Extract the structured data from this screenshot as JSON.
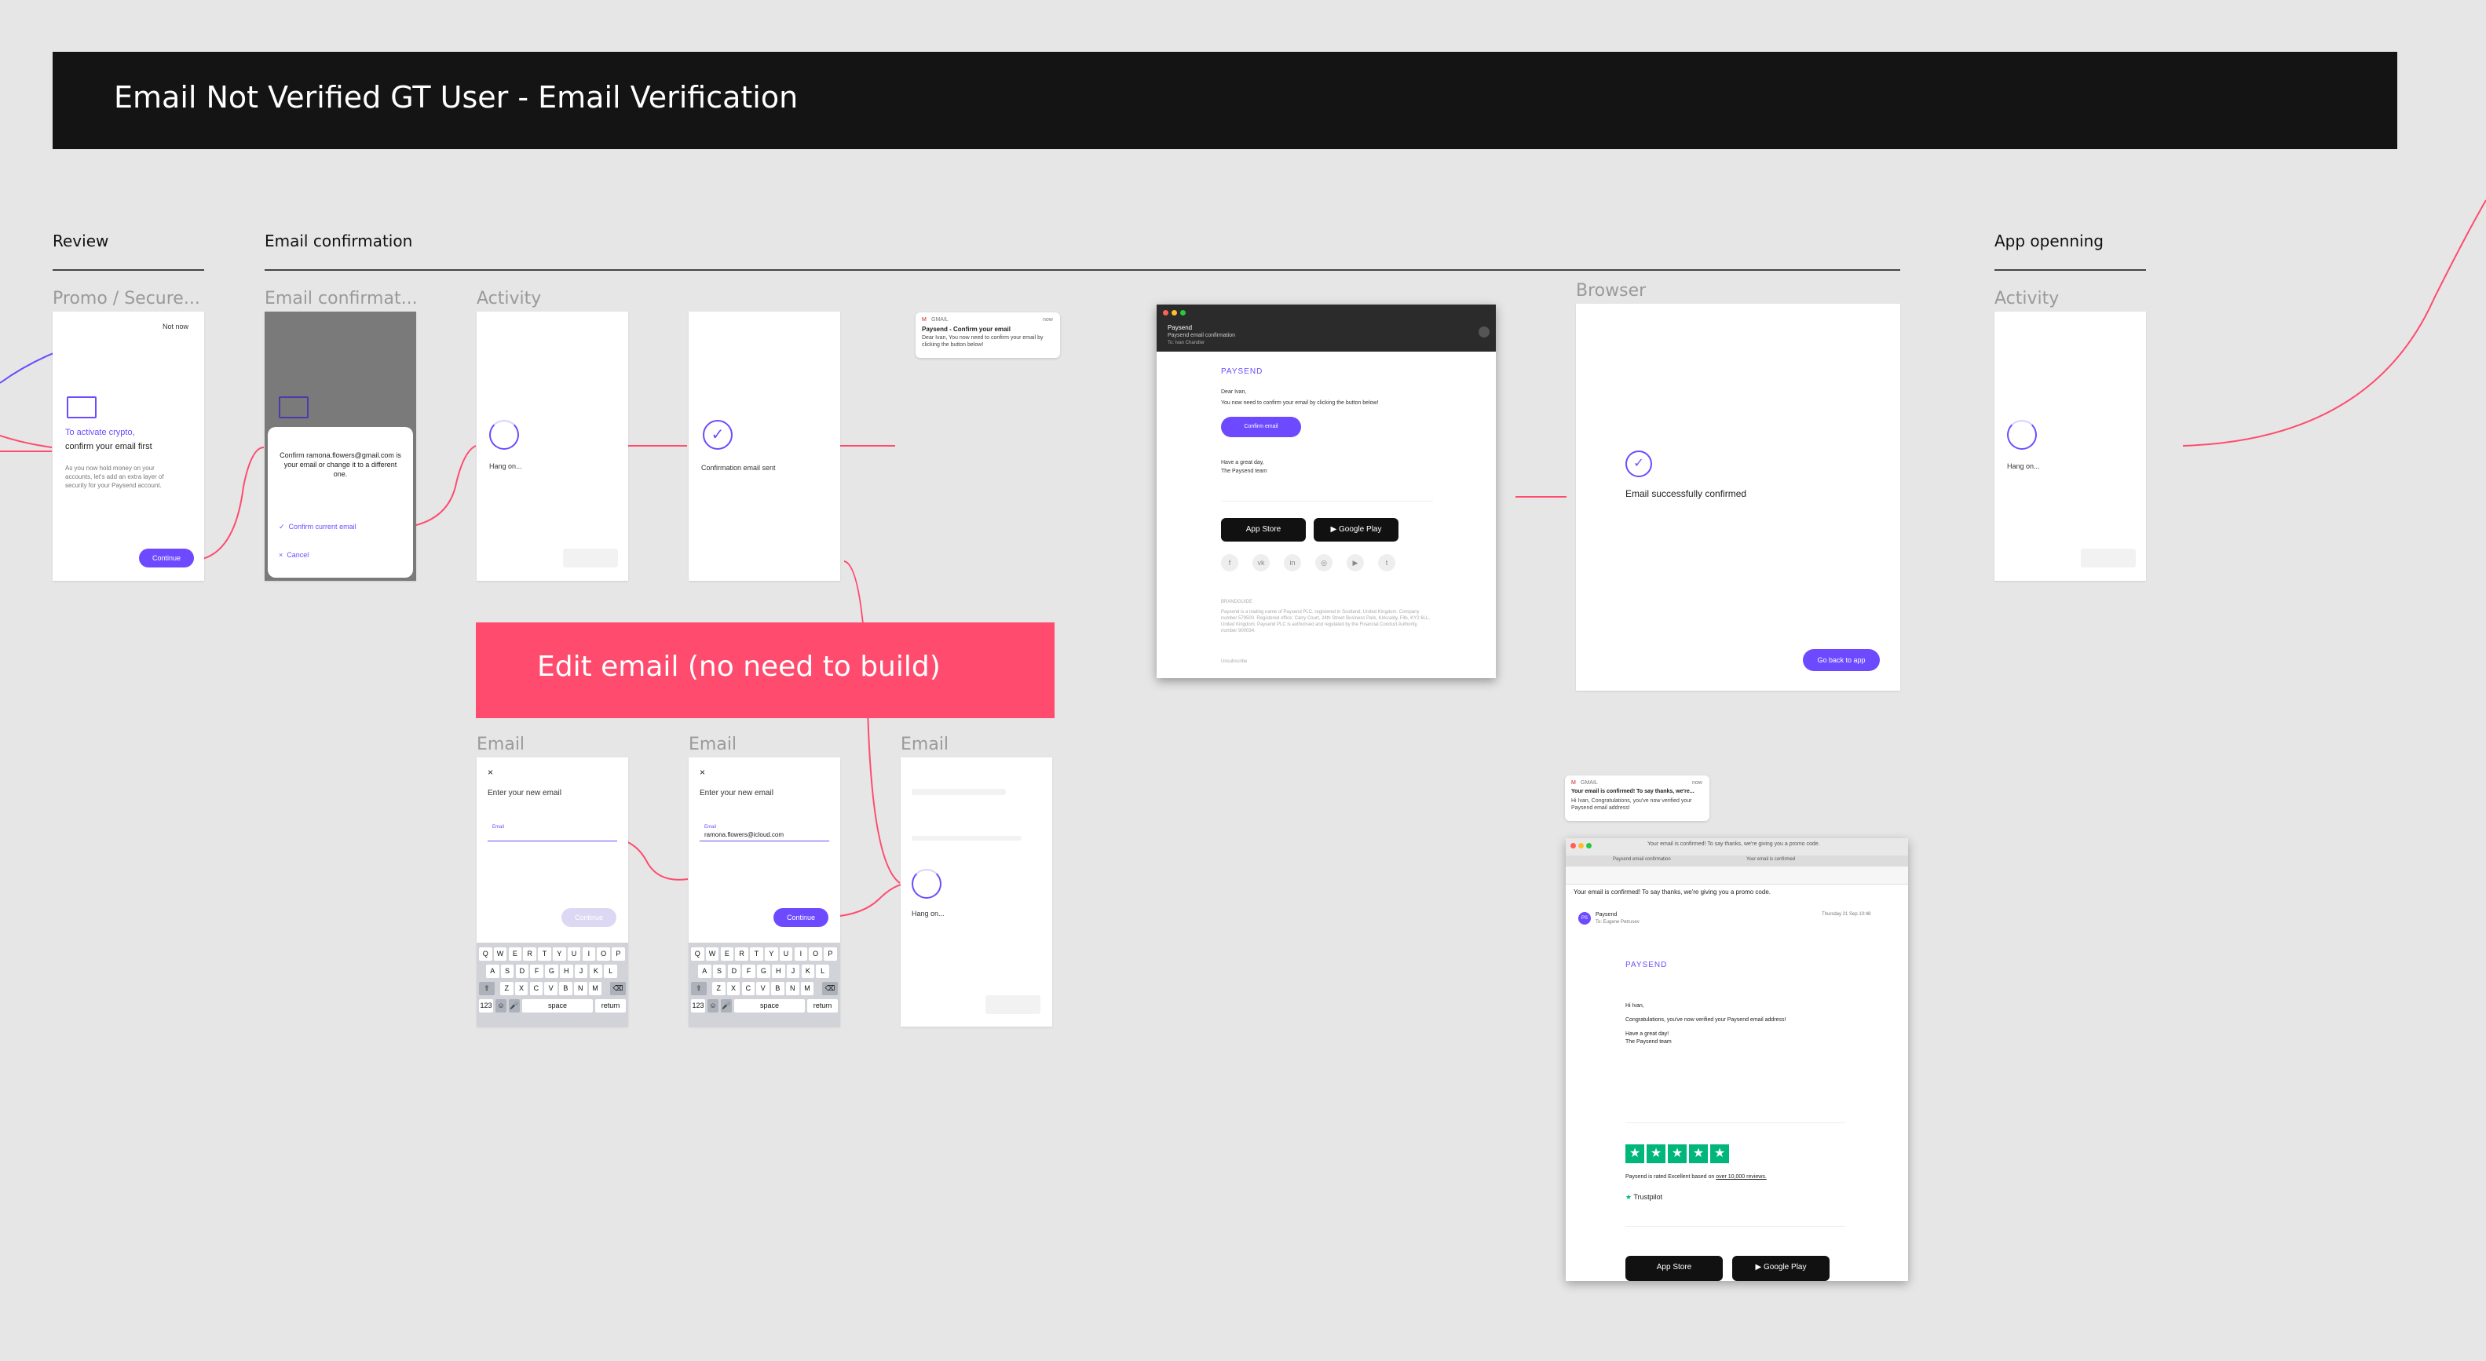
{
  "header": {
    "title": "Email Not Verified GT User - Email Verification"
  },
  "sections": {
    "review": "Review",
    "email_confirmation": "Email confirmation",
    "app_opening": "App openning"
  },
  "frame_labels": {
    "promo": "Promo / Secure...",
    "email_confirm": "Email confirmat...",
    "activity1": "Activity",
    "browser": "Browser",
    "activity2": "Activity",
    "email1": "Email",
    "email2": "Email",
    "email3": "Email"
  },
  "promo": {
    "not_now": "Not now",
    "title_purple": "To activate crypto,",
    "title_dark": "confirm your email first",
    "body": "As you now hold money on your accounts, let's add an extra layer of security for your Paysend account.",
    "continue": "Continue"
  },
  "confirm_sheet": {
    "text": "Confirm ramona.flowers@gmail.com is your email or change it to a different one.",
    "confirm": "Confirm current email",
    "cancel": "Cancel"
  },
  "activity": {
    "hang_on": "Hang on..."
  },
  "sent": {
    "text": "Confirmation email sent"
  },
  "gmail_notif1": {
    "app": "GMAIL",
    "time": "now",
    "title": "Paysend - Confirm your email",
    "body": "Dear Ivan, You now need to confirm your email by clicking the button below!"
  },
  "mail_app": {
    "from": "Paysend",
    "subject": "Paysend email confirmation",
    "to": "To: Ivan Chandler",
    "brand": "PAYSEND",
    "greeting": "Dear Ivan,",
    "line": "You now need to confirm your email by clicking the button below!",
    "button": "Confirm email",
    "signoff1": "Have a great day,",
    "signoff2": "The Paysend team",
    "app_store": "App Store",
    "google_play": "Google Play",
    "footer_label": "BRANDGUIDE",
    "footer": "Paysend is a trading name of Paysend PLC, registered in Scotland, United Kingdom. Company number 579500. Registered office: Carry Court, 24th Street Business Park, Kirkcaldy, Fife, KY2 6LL, United Kingdom. Paysend PLC is authorised and regulated by the Financial Conduct Authority, number 900034.",
    "unsubscribe": "Unsubscribe"
  },
  "browser": {
    "text": "Email successfully confirmed",
    "button": "Go back to app"
  },
  "pink_banner": {
    "text": "Edit email (no need to build)"
  },
  "email_screen1": {
    "close": "×",
    "title": "Enter your new email",
    "field_label": "Email",
    "value": "",
    "button": "Continue"
  },
  "email_screen2": {
    "close": "×",
    "title": "Enter your new email",
    "field_label": "Email",
    "value": "ramona.flowers@icloud.com",
    "button": "Continue"
  },
  "keyboard": {
    "row1": [
      "Q",
      "W",
      "E",
      "R",
      "T",
      "Y",
      "U",
      "I",
      "O",
      "P"
    ],
    "row2": [
      "A",
      "S",
      "D",
      "F",
      "G",
      "H",
      "J",
      "K",
      "L"
    ],
    "row3": [
      "Z",
      "X",
      "C",
      "V",
      "B",
      "N",
      "M"
    ],
    "num": "123",
    "space": "space",
    "return": "return"
  },
  "gmail_notif2": {
    "app": "GMAIL",
    "time": "now",
    "title": "Your email is confirmed! To say thanks, we're...",
    "body": "Hi Ivan, Congratulations, you've now verified your Paysend email address!"
  },
  "mail2": {
    "window_title": "Your email is confirmed! To say thanks, we're giving you a promo code.",
    "tab1": "Paysend email confirmation",
    "tab2": "Your email is confirmed",
    "subject": "Your email is confirmed! To say thanks, we're giving you a promo code.",
    "from": "Paysend",
    "to": "To: Eugene Petrusev",
    "date": "Thursday 21 Sep 10:48",
    "brand": "PAYSEND",
    "greeting": "Hi Ivan,",
    "line": "Congratulations, you've now verified your Paysend email address!",
    "signoff1": "Have a great day!",
    "signoff2": "The Paysend team",
    "rating_text": "Paysend is rated Excellent based on",
    "rating_link": "over 10,000 reviews.",
    "trustpilot": "Trustpilot",
    "app_store": "App Store",
    "google_play": "Google Play"
  }
}
